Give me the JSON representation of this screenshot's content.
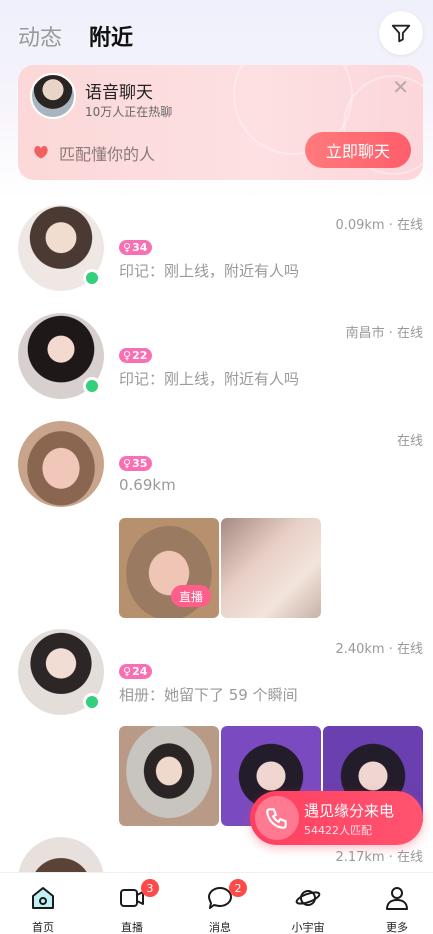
{
  "header": {
    "tabs": [
      {
        "label": "动态",
        "active": false
      },
      {
        "label": "附近",
        "active": true
      }
    ],
    "filter_icon": "filter-icon"
  },
  "voice_card": {
    "title": "语音聊天",
    "subtitle": "10万人正在热聊",
    "match_text": "匹配懂你的人",
    "button_label": "立即聊天",
    "close_icon": "close-icon"
  },
  "users": [
    {
      "distance_status": "0.09km · 在线",
      "age": "34",
      "bio": "印记：刚上线，附近有人吗",
      "online": true
    },
    {
      "distance_status": "南昌市 · 在线",
      "age": "22",
      "bio": "印记：刚上线，附近有人吗",
      "online": true
    },
    {
      "distance_status": "在线",
      "age": "35",
      "bio": "0.69km",
      "online": false,
      "live_tag": "直播"
    },
    {
      "distance_status": "2.40km · 在线",
      "age": "24",
      "bio": "相册：她留下了 59 个瞬间",
      "online": true
    },
    {
      "distance_status": "2.17km · 在线"
    }
  ],
  "fate_call": {
    "title": "遇见缘分来电",
    "subtitle": "54422人匹配"
  },
  "bottom_nav": [
    {
      "label": "首页",
      "icon": "home-icon",
      "active": true,
      "badge": ""
    },
    {
      "label": "直播",
      "icon": "video-icon",
      "active": false,
      "badge": "3"
    },
    {
      "label": "消息",
      "icon": "message-icon",
      "active": false,
      "badge": "2"
    },
    {
      "label": "小宇宙",
      "icon": "planet-icon",
      "active": false,
      "badge": ""
    },
    {
      "label": "更多",
      "icon": "profile-icon",
      "active": false,
      "badge": ""
    }
  ],
  "colors": {
    "accent": "#ff5e6a",
    "age_badge": "#f86fb3",
    "online": "#33cf7a",
    "nav_active": "#1aa5b8"
  }
}
